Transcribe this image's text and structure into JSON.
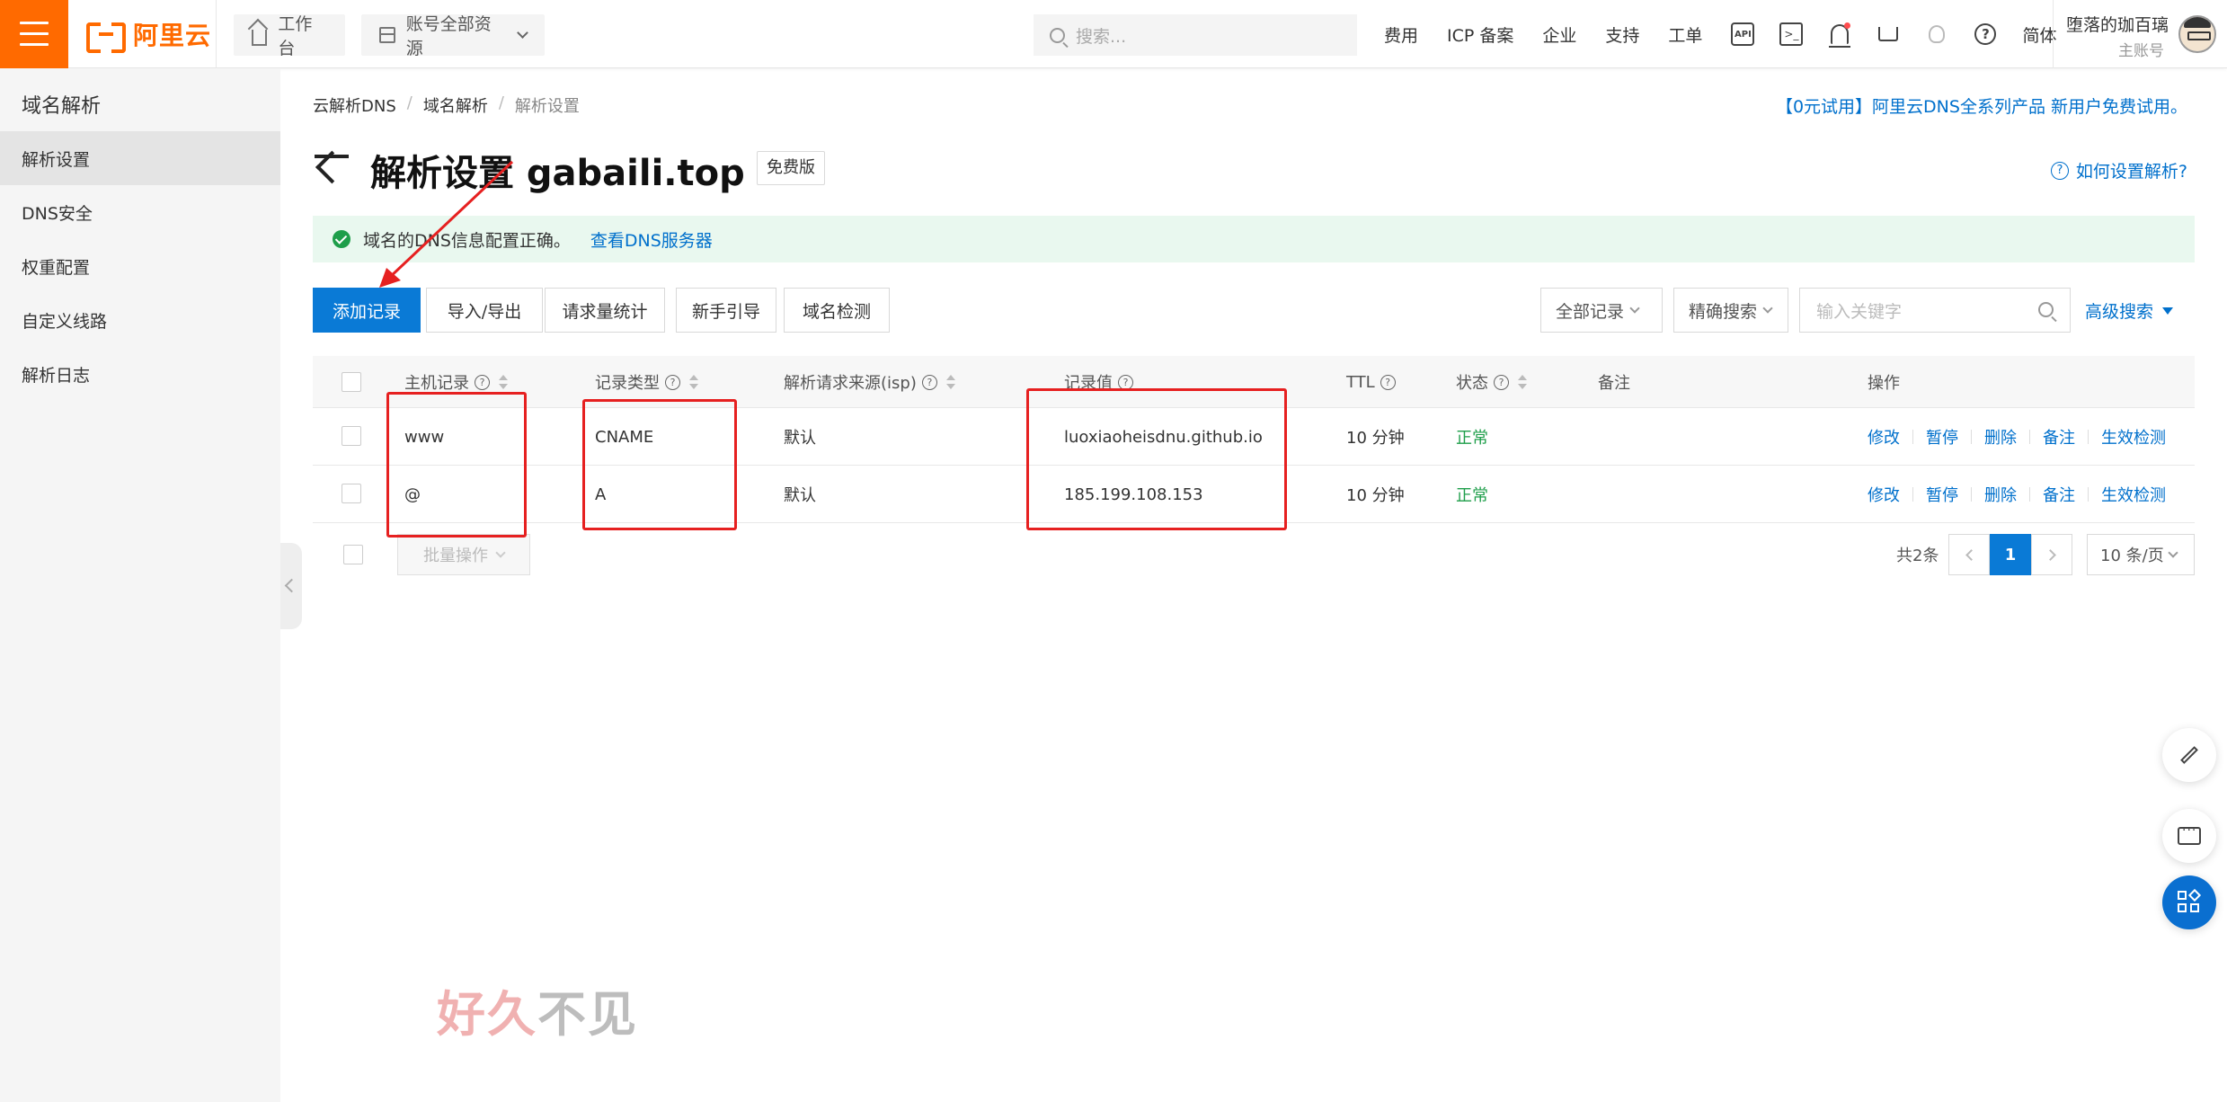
{
  "topbar": {
    "brand": "阿里云",
    "workbench": "工作台",
    "resources": "账号全部资源",
    "search_placeholder": "搜索...",
    "links": [
      "费用",
      "ICP 备案",
      "企业",
      "支持",
      "工单"
    ],
    "icon_api": "API",
    "icon_terminal": ">_",
    "lang": "简体",
    "user_name": "堕落的珈百璃",
    "user_role": "主账号"
  },
  "sidebar": {
    "title": "域名解析",
    "items": [
      {
        "label": "解析设置",
        "active": true
      },
      {
        "label": "DNS安全"
      },
      {
        "label": "权重配置"
      },
      {
        "label": "自定义线路"
      },
      {
        "label": "解析日志"
      }
    ]
  },
  "breadcrumb": [
    "云解析DNS",
    "域名解析",
    "解析设置"
  ],
  "promo": "【0元试用】阿里云DNS全系列产品 新用户免费试用。",
  "page": {
    "title": "解析设置 gabaili.top",
    "edition": "免费版",
    "help_link": "如何设置解析?"
  },
  "alert": {
    "message": "域名的DNS信息配置正确。",
    "link": "查看DNS服务器"
  },
  "toolbar": {
    "add": "添加记录",
    "import_export": "导入/导出",
    "stats": "请求量统计",
    "guide": "新手引导",
    "check": "域名检测",
    "filter_all": "全部记录",
    "filter_exact": "精确搜索",
    "keyword_placeholder": "输入关键字",
    "advanced": "高级搜索"
  },
  "table": {
    "headers": {
      "host": "主机记录",
      "type": "记录类型",
      "isp": "解析请求来源(isp)",
      "value": "记录值",
      "ttl": "TTL",
      "status": "状态",
      "remark": "备注",
      "ops": "操作"
    },
    "rows": [
      {
        "host": "www",
        "type": "CNAME",
        "isp": "默认",
        "value": "luoxiaoheisdnu.github.io",
        "ttl": "10 分钟",
        "status": "正常"
      },
      {
        "host": "@",
        "type": "A",
        "isp": "默认",
        "value": "185.199.108.153",
        "ttl": "10 分钟",
        "status": "正常"
      }
    ],
    "ops": [
      "修改",
      "暂停",
      "删除",
      "备注",
      "生效检测"
    ]
  },
  "footer": {
    "batch": "批量操作",
    "total": "共2条",
    "current_page": "1",
    "page_size": "10 条/页"
  },
  "watermark": {
    "part1": "好久",
    "part2": "不见"
  },
  "colors": {
    "brand": "#ff6a00",
    "primary": "#0a7ad6",
    "link": "#0070cc",
    "success": "#1e9e4a",
    "annotation": "#e62020"
  }
}
